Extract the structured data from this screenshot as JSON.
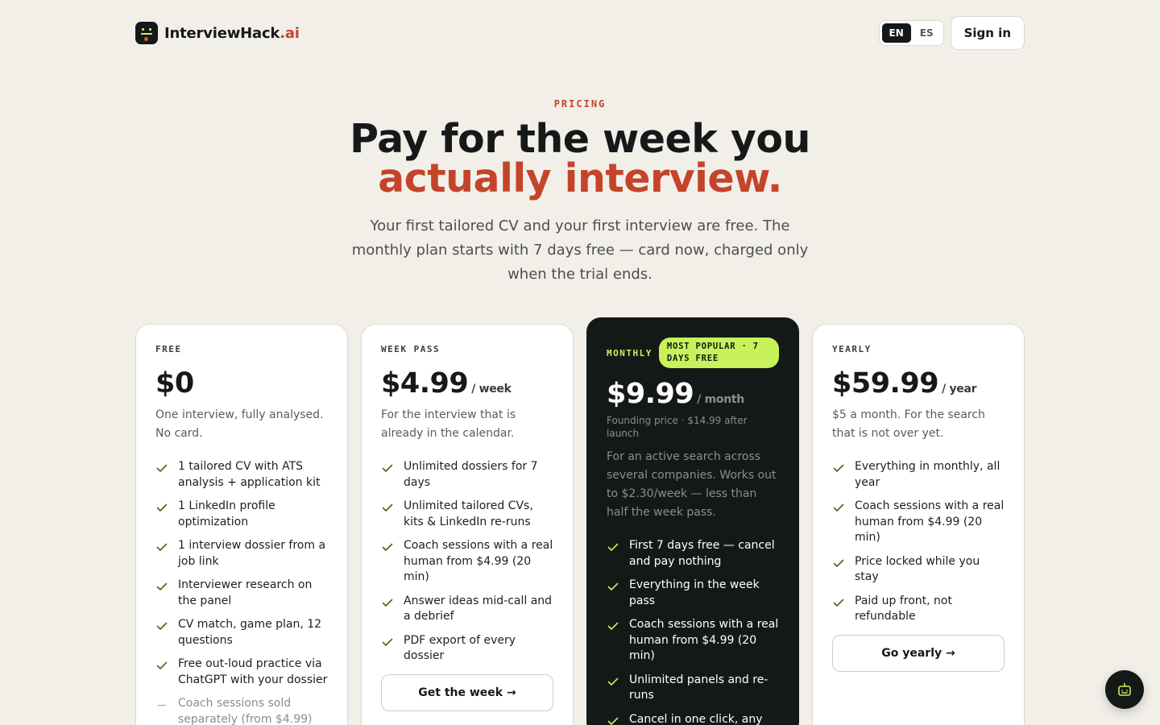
{
  "header": {
    "brand_name": "InterviewHack",
    "brand_tld": ".ai",
    "lang_options": [
      "EN",
      "ES"
    ],
    "lang_active": "EN",
    "signin_label": "Sign in"
  },
  "hero": {
    "eyebrow": "PRICING",
    "headline_line1": "Pay for the week you",
    "headline_line2": "actually interview.",
    "subtitle": "Your first tailored CV and your first interview are free. The monthly plan starts with 7 days free — card now, charged only when the trial ends."
  },
  "plans": [
    {
      "name": "FREE",
      "price": "$0",
      "period": "",
      "description": "One interview, fully analysed. No card.",
      "features": [
        "1 tailored CV with ATS analysis + application kit",
        "1 LinkedIn profile optimization",
        "1 interview dossier from a job link",
        "Interviewer research on the panel",
        "CV match, game plan, 12 questions",
        "Free out-loud practice via ChatGPT with your dossier"
      ],
      "muted_feature": "Coach sessions sold separately (from $4.99)"
    },
    {
      "name": "WEEK PASS",
      "price": "$4.99",
      "period": "/ week",
      "description": "For the interview that is already in the calendar.",
      "features": [
        "Unlimited dossiers for 7 days",
        "Unlimited tailored CVs, kits & LinkedIn re-runs",
        "Coach sessions with a real human from $4.99 (20 min)",
        "Answer ideas mid-call and a debrief",
        "PDF export of every dossier"
      ],
      "cta_label": "Get the week →"
    },
    {
      "name": "MONTHLY",
      "badge": "MOST POPULAR · 7 DAYS FREE",
      "price": "$9.99",
      "period": "/ month",
      "founding": "Founding price · $14.99 after launch",
      "description": "For an active search across several companies. Works out to $2.30/week — less than half the week pass.",
      "features": [
        "First 7 days free — cancel and pay nothing",
        "Everything in the week pass",
        "Coach sessions with a real human from $4.99 (20 min)",
        "Unlimited panels and re-runs",
        "Cancel in one click, any"
      ]
    },
    {
      "name": "YEARLY",
      "price": "$59.99",
      "period": "/ year",
      "description": "$5 a month. For the search that is not over yet.",
      "features": [
        "Everything in monthly, all year",
        "Coach sessions with a real human from $4.99 (20 min)",
        "Price locked while you stay",
        "Paid up front, not refundable"
      ],
      "cta_label": "Go yearly →"
    }
  ],
  "colors": {
    "background": "#f1efe8",
    "accent": "#c4442a",
    "lime": "#c7f25a",
    "dark": "#141917",
    "check": "#3f6a1a"
  },
  "icons": {
    "check": "check-icon",
    "help": "bot-icon"
  }
}
